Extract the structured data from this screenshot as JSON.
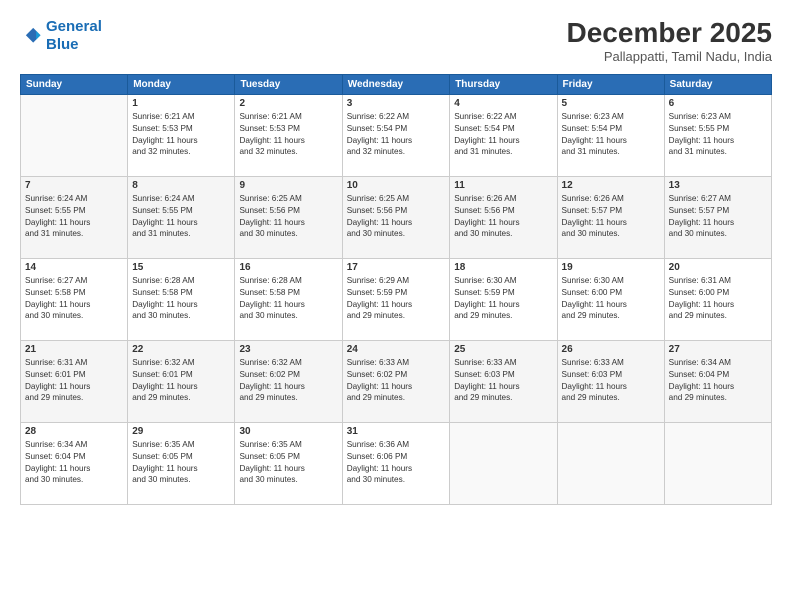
{
  "logo": {
    "line1": "General",
    "line2": "Blue"
  },
  "title": "December 2025",
  "subtitle": "Pallappatti, Tamil Nadu, India",
  "days_header": [
    "Sunday",
    "Monday",
    "Tuesday",
    "Wednesday",
    "Thursday",
    "Friday",
    "Saturday"
  ],
  "weeks": [
    [
      {
        "num": "",
        "info": ""
      },
      {
        "num": "1",
        "info": "Sunrise: 6:21 AM\nSunset: 5:53 PM\nDaylight: 11 hours\nand 32 minutes."
      },
      {
        "num": "2",
        "info": "Sunrise: 6:21 AM\nSunset: 5:53 PM\nDaylight: 11 hours\nand 32 minutes."
      },
      {
        "num": "3",
        "info": "Sunrise: 6:22 AM\nSunset: 5:54 PM\nDaylight: 11 hours\nand 32 minutes."
      },
      {
        "num": "4",
        "info": "Sunrise: 6:22 AM\nSunset: 5:54 PM\nDaylight: 11 hours\nand 31 minutes."
      },
      {
        "num": "5",
        "info": "Sunrise: 6:23 AM\nSunset: 5:54 PM\nDaylight: 11 hours\nand 31 minutes."
      },
      {
        "num": "6",
        "info": "Sunrise: 6:23 AM\nSunset: 5:55 PM\nDaylight: 11 hours\nand 31 minutes."
      }
    ],
    [
      {
        "num": "7",
        "info": "Sunrise: 6:24 AM\nSunset: 5:55 PM\nDaylight: 11 hours\nand 31 minutes."
      },
      {
        "num": "8",
        "info": "Sunrise: 6:24 AM\nSunset: 5:55 PM\nDaylight: 11 hours\nand 31 minutes."
      },
      {
        "num": "9",
        "info": "Sunrise: 6:25 AM\nSunset: 5:56 PM\nDaylight: 11 hours\nand 30 minutes."
      },
      {
        "num": "10",
        "info": "Sunrise: 6:25 AM\nSunset: 5:56 PM\nDaylight: 11 hours\nand 30 minutes."
      },
      {
        "num": "11",
        "info": "Sunrise: 6:26 AM\nSunset: 5:56 PM\nDaylight: 11 hours\nand 30 minutes."
      },
      {
        "num": "12",
        "info": "Sunrise: 6:26 AM\nSunset: 5:57 PM\nDaylight: 11 hours\nand 30 minutes."
      },
      {
        "num": "13",
        "info": "Sunrise: 6:27 AM\nSunset: 5:57 PM\nDaylight: 11 hours\nand 30 minutes."
      }
    ],
    [
      {
        "num": "14",
        "info": "Sunrise: 6:27 AM\nSunset: 5:58 PM\nDaylight: 11 hours\nand 30 minutes."
      },
      {
        "num": "15",
        "info": "Sunrise: 6:28 AM\nSunset: 5:58 PM\nDaylight: 11 hours\nand 30 minutes."
      },
      {
        "num": "16",
        "info": "Sunrise: 6:28 AM\nSunset: 5:58 PM\nDaylight: 11 hours\nand 30 minutes."
      },
      {
        "num": "17",
        "info": "Sunrise: 6:29 AM\nSunset: 5:59 PM\nDaylight: 11 hours\nand 29 minutes."
      },
      {
        "num": "18",
        "info": "Sunrise: 6:30 AM\nSunset: 5:59 PM\nDaylight: 11 hours\nand 29 minutes."
      },
      {
        "num": "19",
        "info": "Sunrise: 6:30 AM\nSunset: 6:00 PM\nDaylight: 11 hours\nand 29 minutes."
      },
      {
        "num": "20",
        "info": "Sunrise: 6:31 AM\nSunset: 6:00 PM\nDaylight: 11 hours\nand 29 minutes."
      }
    ],
    [
      {
        "num": "21",
        "info": "Sunrise: 6:31 AM\nSunset: 6:01 PM\nDaylight: 11 hours\nand 29 minutes."
      },
      {
        "num": "22",
        "info": "Sunrise: 6:32 AM\nSunset: 6:01 PM\nDaylight: 11 hours\nand 29 minutes."
      },
      {
        "num": "23",
        "info": "Sunrise: 6:32 AM\nSunset: 6:02 PM\nDaylight: 11 hours\nand 29 minutes."
      },
      {
        "num": "24",
        "info": "Sunrise: 6:33 AM\nSunset: 6:02 PM\nDaylight: 11 hours\nand 29 minutes."
      },
      {
        "num": "25",
        "info": "Sunrise: 6:33 AM\nSunset: 6:03 PM\nDaylight: 11 hours\nand 29 minutes."
      },
      {
        "num": "26",
        "info": "Sunrise: 6:33 AM\nSunset: 6:03 PM\nDaylight: 11 hours\nand 29 minutes."
      },
      {
        "num": "27",
        "info": "Sunrise: 6:34 AM\nSunset: 6:04 PM\nDaylight: 11 hours\nand 29 minutes."
      }
    ],
    [
      {
        "num": "28",
        "info": "Sunrise: 6:34 AM\nSunset: 6:04 PM\nDaylight: 11 hours\nand 30 minutes."
      },
      {
        "num": "29",
        "info": "Sunrise: 6:35 AM\nSunset: 6:05 PM\nDaylight: 11 hours\nand 30 minutes."
      },
      {
        "num": "30",
        "info": "Sunrise: 6:35 AM\nSunset: 6:05 PM\nDaylight: 11 hours\nand 30 minutes."
      },
      {
        "num": "31",
        "info": "Sunrise: 6:36 AM\nSunset: 6:06 PM\nDaylight: 11 hours\nand 30 minutes."
      },
      {
        "num": "",
        "info": ""
      },
      {
        "num": "",
        "info": ""
      },
      {
        "num": "",
        "info": ""
      }
    ]
  ]
}
